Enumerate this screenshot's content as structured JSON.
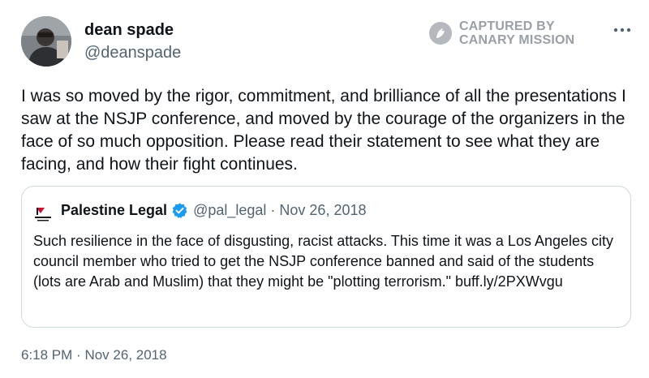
{
  "author": {
    "display_name": "dean spade",
    "handle": "@deanspade"
  },
  "watermark": {
    "line1": "CAPTURED BY",
    "line2": "CANARY MISSION",
    "icon": "canary-bird-icon"
  },
  "more_icon": "ellipsis-icon",
  "tweet_text": "I was so moved by the rigor, commitment, and brilliance of all the presentations I saw at the NSJP conference, and moved by the courage of the organizers in the face of so much opposition. Please read their statement to see what they are facing, and how their fight continues.",
  "quote": {
    "display_name": "Palestine Legal",
    "handle": "@pal_legal",
    "separator": "·",
    "date": "Nov 26, 2018",
    "verified": true,
    "text": "Such resilience in the face of disgusting, racist attacks. This time it was a Los Angeles city council member who tried to get the NSJP conference banned and said of the students (lots are Arab and Muslim) that they might be \"plotting terrorism.\" buff.ly/2PXWvgu"
  },
  "timestamp": {
    "time": "6:18 PM",
    "separator": "·",
    "date": "Nov 26, 2018"
  },
  "colors": {
    "text": "#0f1419",
    "secondary": "#536471",
    "border": "#cfd9de",
    "verified": "#1d9bf0",
    "watermark": "#9aa0a6"
  }
}
